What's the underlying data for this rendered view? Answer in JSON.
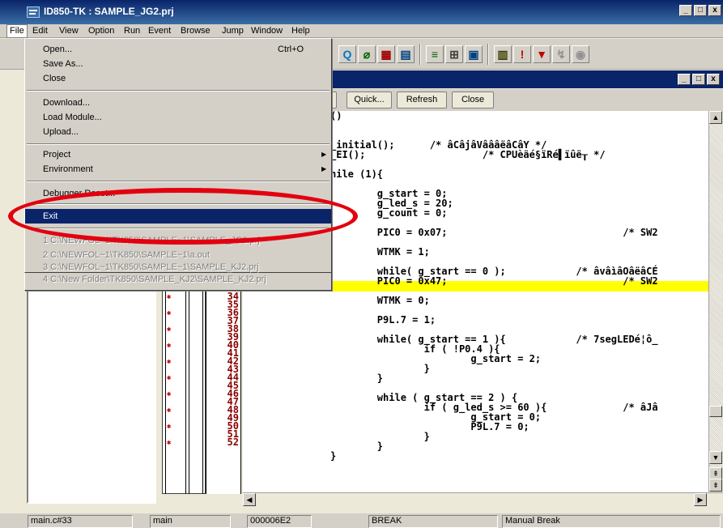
{
  "window": {
    "title": "ID850-TK : SAMPLE_JG2.prj",
    "buttons": [
      "_",
      "□",
      "x"
    ]
  },
  "menubar": [
    "File",
    "Edit",
    "View",
    "Option",
    "Run",
    "Event",
    "Browse",
    "Jump",
    "Window",
    "Help"
  ],
  "file_menu": {
    "open": "Open...",
    "open_shortcut": "Ctrl+O",
    "save_as": "Save As...",
    "close": "Close",
    "download": "Download...",
    "load_module": "Load Module...",
    "upload": "Upload...",
    "project": "Project",
    "environment": "Environment",
    "debugger_reset": "Debugger Reset...",
    "exit": "Exit",
    "recent": [
      "1 C:\\NEWFOL~1\\TK850\\SAMPLE~1\\SAMPLE_JG2.prj",
      "2 C:\\NEWFOL~1\\TK850\\SAMPLE~1\\a.out",
      "3 C:\\NEWFOL~1\\TK850\\SAMPLE~1\\SAMPLE_KJ2.prj",
      "4 C:\\New Folder\\TK850\\SAMPLE_KJ2\\SAMPLE_KJ2.prj"
    ]
  },
  "source_toolbar": {
    "quick": "Quick...",
    "refresh": "Refresh",
    "close": "Close"
  },
  "line_numbers": [
    "34",
    "35",
    "36",
    "37",
    "38",
    "39",
    "40",
    "41",
    "42",
    "43",
    "44",
    "45",
    "46",
    "47",
    "48",
    "49",
    "50",
    "51",
    "52"
  ],
  "code_lines": [
    "()",
    "",
    "",
    "_initial();      /* âCâjâVâââëâCâY */",
    "_EI();                    /* CPUèäé§ïRé▌ïûë┰ */",
    "",
    "hile (1){",
    "",
    "        g_start = 0;",
    "        g_led_s = 20;",
    "        g_count = 0;",
    "",
    "        PIC0 = 0x07;                              /* SW2",
    "",
    "        WTMK = 1;",
    "",
    "        while( g_start == 0 );            /* âvâìâOâëâCÉ",
    "        PIC0 = 0x47;                              /* SW2",
    "",
    "        WTMK = 0;",
    "",
    "        P9L.7 = 1;",
    "",
    "        while( g_start == 1 ){            /* 7segLEDé¦ô_",
    "                if ( !P0.4 ){",
    "                        g_start = 2;",
    "                }",
    "        }",
    "",
    "        while ( g_start == 2 ) {",
    "                if ( g_led_s >= 60 ){             /* âJâ",
    "                        g_start = 0;",
    "                        P9L.7 = 0;",
    "                }",
    "        }",
    "}"
  ],
  "statusbar": {
    "file": "main.c#33",
    "function": "main",
    "address": "000006E2",
    "state": "BREAK",
    "reason": "Manual Break"
  },
  "colors": {
    "title_bar": "#0a246a",
    "menu_selection": "#0a246a",
    "highlight_line": "#ffff00",
    "annotation_ellipse": "#e3000f",
    "line_number": "#8b0000"
  }
}
